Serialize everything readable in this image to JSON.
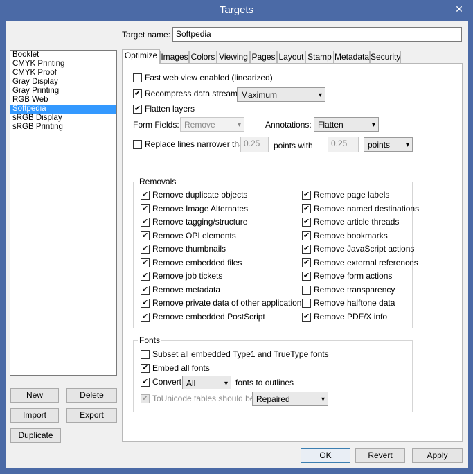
{
  "window": {
    "title": "Targets",
    "close_glyph": "✕"
  },
  "target_name": {
    "label": "Target name:",
    "value": "Softpedia"
  },
  "targets": [
    "Booklet",
    "CMYK Printing",
    "CMYK Proof",
    "Gray Display",
    "Gray Printing",
    "RGB Web",
    "Softpedia",
    "sRGB Display",
    "sRGB Printing"
  ],
  "selected_target": "Softpedia",
  "buttons": {
    "new": "New",
    "delete": "Delete",
    "import": "Import",
    "export": "Export",
    "duplicate": "Duplicate",
    "ok": "OK",
    "revert": "Revert",
    "apply": "Apply"
  },
  "tabs": [
    "Optimize",
    "Images",
    "Colors",
    "Viewing",
    "Pages",
    "Layout",
    "Stamp",
    "Metadata",
    "Security"
  ],
  "active_tab": "Optimize",
  "optimize": {
    "fast_web": {
      "label": "Fast web view enabled (linearized)",
      "checked": false
    },
    "recompress": {
      "label": "Recompress data streams",
      "checked": true,
      "select": "Maximum"
    },
    "flatten": {
      "label": "Flatten layers",
      "checked": true
    },
    "form_fields": {
      "label": "Form Fields:",
      "value": "Remove"
    },
    "annotations": {
      "label": "Annotations:",
      "value": "Flatten"
    },
    "replace_lines": {
      "label": "Replace lines narrower than",
      "checked": false,
      "value1": "0.25",
      "mid_label": "points with",
      "value2": "0.25",
      "unit": "points"
    }
  },
  "removals": {
    "title": "Removals",
    "left": [
      {
        "label": "Remove duplicate objects",
        "checked": true
      },
      {
        "label": "Remove Image Alternates",
        "checked": true
      },
      {
        "label": "Remove tagging/structure",
        "checked": true
      },
      {
        "label": "Remove OPI elements",
        "checked": true
      },
      {
        "label": "Remove thumbnails",
        "checked": true
      },
      {
        "label": "Remove embedded files",
        "checked": true
      },
      {
        "label": "Remove job tickets",
        "checked": true
      },
      {
        "label": "Remove metadata",
        "checked": true
      },
      {
        "label": "Remove private data of other applications",
        "checked": true
      },
      {
        "label": "Remove embedded PostScript",
        "checked": true
      }
    ],
    "right": [
      {
        "label": "Remove page labels",
        "checked": true
      },
      {
        "label": "Remove named destinations",
        "checked": true
      },
      {
        "label": "Remove article threads",
        "checked": true
      },
      {
        "label": "Remove bookmarks",
        "checked": true
      },
      {
        "label": "Remove JavaScript actions",
        "checked": true
      },
      {
        "label": "Remove external references",
        "checked": true
      },
      {
        "label": "Remove form actions",
        "checked": true
      },
      {
        "label": "Remove transparency",
        "checked": false
      },
      {
        "label": "Remove halftone data",
        "checked": false
      },
      {
        "label": "Remove PDF/X info",
        "checked": true
      }
    ]
  },
  "fonts": {
    "title": "Fonts",
    "subset": {
      "label": "Subset all embedded Type1 and TrueType fonts",
      "checked": false
    },
    "embed": {
      "label": "Embed all fonts",
      "checked": true
    },
    "convert": {
      "label": "Convert",
      "checked": true,
      "select": "All",
      "suffix": "fonts to outlines"
    },
    "tounicode": {
      "label": "ToUnicode tables should be:",
      "checked": true,
      "select": "Repaired"
    }
  },
  "icons": {
    "check": "✔",
    "caret": "▾"
  }
}
